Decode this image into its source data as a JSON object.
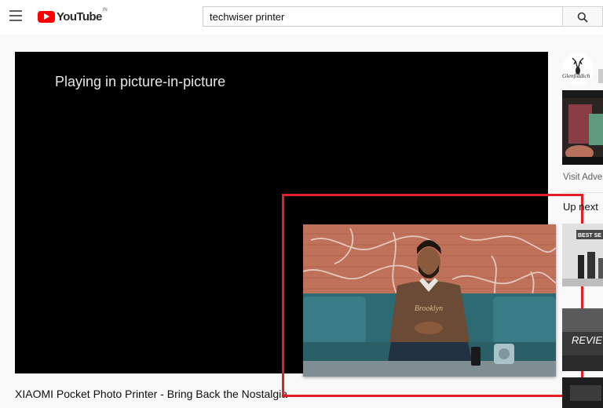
{
  "header": {
    "logo_text": "YouTube",
    "region": "IN",
    "search": {
      "value": "techwiser printer",
      "placeholder": "Search"
    },
    "icons": [
      "menu-icon",
      "search-icon"
    ]
  },
  "player": {
    "pip_message": "Playing in picture-in-picture"
  },
  "video": {
    "title": "XIAOMI Pocket Photo Printer - Bring Back the Nostalgia"
  },
  "pip_window": {
    "shirt_text": "Brooklyn"
  },
  "sidebar": {
    "ad_brand": "Glenfiddich",
    "visit_advertiser": "Visit Advertiser",
    "up_next": "Up next",
    "thumb_labels": [
      "BEST SE",
      "REVIE"
    ]
  },
  "colors": {
    "brand_red": "#ff0000",
    "highlight_red": "#e31e24",
    "player_bg": "#000000"
  }
}
